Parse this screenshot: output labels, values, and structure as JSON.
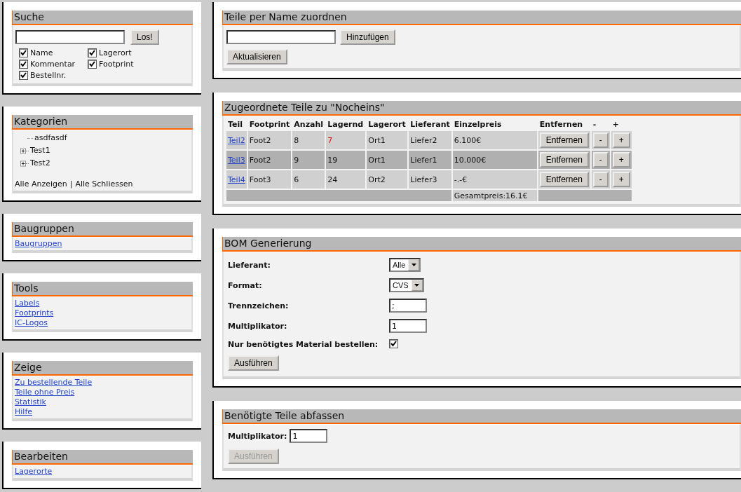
{
  "sidebar": {
    "search": {
      "title": "Suche",
      "button": "Los!",
      "options": [
        {
          "label": "Name",
          "checked": true
        },
        {
          "label": "Lagerort",
          "checked": true
        },
        {
          "label": "Kommentar",
          "checked": true
        },
        {
          "label": "Footprint",
          "checked": true
        },
        {
          "label": "Bestellnr.",
          "checked": true
        }
      ]
    },
    "categories": {
      "title": "Kategorien",
      "items": [
        {
          "label": "asdfasdf",
          "kind": "leaf"
        },
        {
          "label": "Test1",
          "kind": "node",
          "expanded": false
        },
        {
          "label": "Test2",
          "kind": "node",
          "expanded": false
        }
      ],
      "show_all": "Alle Anzeigen",
      "separator": "|",
      "close_all": "Alle Schliessen"
    },
    "link_panels": [
      {
        "title": "Baugruppen",
        "links": [
          "Baugruppen"
        ]
      },
      {
        "title": "Tools",
        "links": [
          "Labels",
          "Footprints",
          "IC-Logos"
        ]
      },
      {
        "title": "Zeige",
        "links": [
          "Zu bestellende Teile",
          "Teile ohne Preis",
          "Statistik",
          "Hilfe"
        ]
      },
      {
        "title": "Bearbeiten",
        "links": [
          "Lagerorte"
        ]
      }
    ]
  },
  "assign_by_name": {
    "title": "Teile per Name zuordnen",
    "add_button": "Hinzufügen",
    "refresh_button": "Aktualisieren"
  },
  "assigned_parts": {
    "title": "Zugeordnete Teile zu \"Nocheins\"",
    "columns": [
      "Teil",
      "Footprint",
      "Anzahl",
      "Lagernd",
      "Lagerort",
      "Lieferant",
      "Einzelpreis",
      "Entfernen",
      "-",
      "+"
    ],
    "rows": [
      {
        "part": "Teil2",
        "footprint": "Foot2",
        "quantity": "8",
        "in_stock": "7",
        "low_stock": true,
        "location": "Ort1",
        "supplier": "Liefer2",
        "unit_price": "6.100€",
        "highlighted": false,
        "remove": "Entfernen",
        "minus": "-",
        "plus": "+"
      },
      {
        "part": "Teil3",
        "footprint": "Foot2",
        "quantity": "9",
        "in_stock": "19",
        "low_stock": false,
        "location": "Ort1",
        "supplier": "Liefer1",
        "unit_price": "10.000€",
        "highlighted": true,
        "remove": "Entfernen",
        "minus": "-",
        "plus": "+"
      },
      {
        "part": "Teil4",
        "footprint": "Foot3",
        "quantity": "6",
        "in_stock": "24",
        "low_stock": false,
        "location": "Ort2",
        "supplier": "Liefer3",
        "unit_price": "-.-€",
        "highlighted": false,
        "remove": "Entfernen",
        "minus": "-",
        "plus": "+"
      }
    ],
    "total": "Gesamtpreis:16.1€"
  },
  "bom": {
    "title": "BOM Generierung",
    "fields": [
      {
        "label": "Lieferant:",
        "kind": "select",
        "value": "Alle"
      },
      {
        "label": "Format:",
        "kind": "select",
        "value": "CVS"
      },
      {
        "label": "Trennzeichen:",
        "kind": "text",
        "value": ";"
      },
      {
        "label": "Multiplikator:",
        "kind": "text",
        "value": "1"
      },
      {
        "label": "Nur benötigtes Material bestellen:",
        "kind": "checkbox",
        "checked": true
      }
    ],
    "button": "Ausführen"
  },
  "needed_parts": {
    "title": "Benötigte Teile abfassen",
    "label": "Multiplikator:",
    "value": "1",
    "button": "Ausführen",
    "button_disabled": true
  }
}
